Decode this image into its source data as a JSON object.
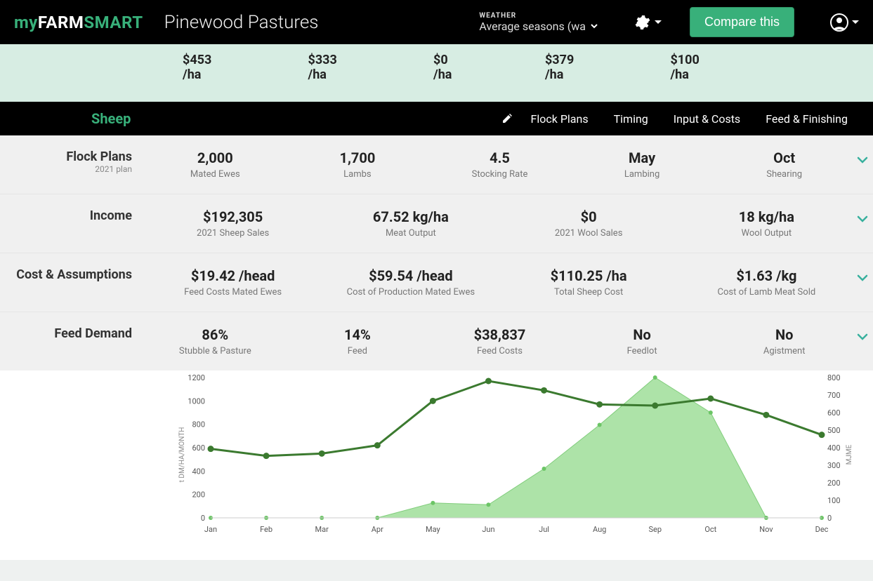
{
  "brand": {
    "prefix": "my",
    "mid": "FARM",
    "suffix": "SMART"
  },
  "farm_name": "Pinewood Pastures",
  "weather": {
    "label": "WEATHER",
    "selected": "Average seasons (wa"
  },
  "compare_label": "Compare this",
  "summary_strip": [
    "$453 /ha",
    "$333 /ha",
    "$0 /ha",
    "$379 /ha",
    "$100 /ha"
  ],
  "section": {
    "current": "Sheep",
    "links": [
      "Flock Plans",
      "Timing",
      "Input & Costs",
      "Feed & Finishing"
    ]
  },
  "rows": [
    {
      "label": "Flock Plans",
      "sub": "2021 plan",
      "metrics": [
        {
          "val": "2,000",
          "lbl": "Mated Ewes"
        },
        {
          "val": "1,700",
          "lbl": "Lambs"
        },
        {
          "val": "4.5",
          "lbl": "Stocking Rate"
        },
        {
          "val": "May",
          "lbl": "Lambing"
        },
        {
          "val": "Oct",
          "lbl": "Shearing"
        }
      ]
    },
    {
      "label": "Income",
      "metrics": [
        {
          "val": "$192,305",
          "lbl": "2021 Sheep Sales"
        },
        {
          "val": "67.52 kg/ha",
          "lbl": "Meat Output"
        },
        {
          "val": "$0",
          "lbl": "2021 Wool Sales"
        },
        {
          "val": "18 kg/ha",
          "lbl": "Wool Output"
        }
      ]
    },
    {
      "label": "Cost & Assumptions",
      "metrics": [
        {
          "val": "$19.42 /head",
          "lbl": "Feed Costs Mated Ewes"
        },
        {
          "val": "$59.54 /head",
          "lbl": "Cost of Production Mated Ewes"
        },
        {
          "val": "$110.25 /ha",
          "lbl": "Total Sheep Cost"
        },
        {
          "val": "$1.63 /kg",
          "lbl": "Cost of Lamb Meat Sold"
        }
      ]
    },
    {
      "label": "Feed Demand",
      "metrics": [
        {
          "val": "86%",
          "lbl": "Stubble & Pasture"
        },
        {
          "val": "14%",
          "lbl": "Feed"
        },
        {
          "val": "$38,837",
          "lbl": "Feed Costs"
        },
        {
          "val": "No",
          "lbl": "Feedlot"
        },
        {
          "val": "No",
          "lbl": "Agistment"
        }
      ]
    }
  ],
  "chart_data": {
    "type": "line+area",
    "categories": [
      "Jan",
      "Feb",
      "Mar",
      "Apr",
      "May",
      "Jun",
      "Jul",
      "Aug",
      "Sep",
      "Oct",
      "Nov",
      "Dec"
    ],
    "y_left": {
      "label": "t DM/HA/MONTH",
      "ticks": [
        0,
        200,
        400,
        600,
        800,
        1000,
        1200
      ],
      "range": [
        0,
        1200
      ]
    },
    "y_right": {
      "label": "MJME",
      "ticks": [
        0,
        100,
        200,
        300,
        400,
        500,
        600,
        700,
        800
      ],
      "range": [
        0,
        800
      ]
    },
    "series": [
      {
        "name": "demand_line",
        "axis": "left",
        "style": "line",
        "values": [
          590,
          530,
          550,
          620,
          1000,
          1170,
          1090,
          970,
          960,
          1020,
          880,
          710
        ]
      },
      {
        "name": "supply_area",
        "axis": "right",
        "style": "area",
        "values": [
          0,
          0,
          0,
          0,
          85,
          75,
          280,
          530,
          800,
          600,
          0,
          0
        ]
      }
    ]
  }
}
